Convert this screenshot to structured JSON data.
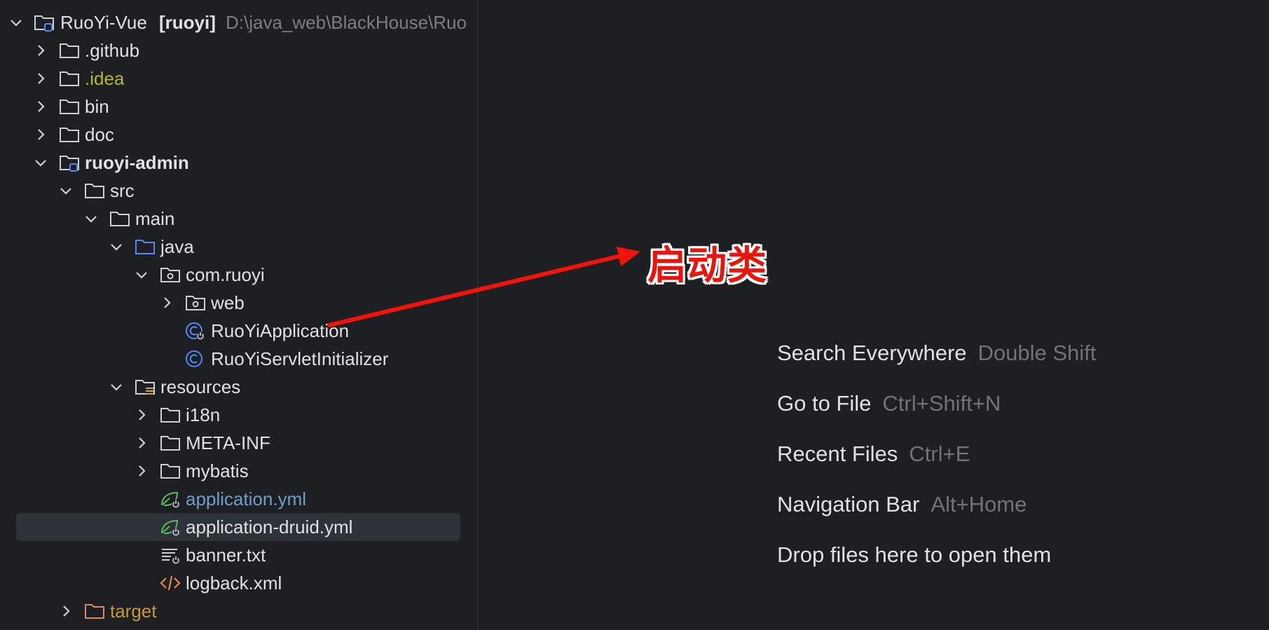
{
  "tree": {
    "root": {
      "name": "RuoYi-Vue",
      "module": "[ruoyi]",
      "path": "D:\\java_web\\BlackHouse\\Ruo"
    },
    "items": [
      {
        "label": ".github"
      },
      {
        "label": ".idea"
      },
      {
        "label": "bin"
      },
      {
        "label": "doc"
      },
      {
        "label": "ruoyi-admin"
      },
      {
        "label": "src"
      },
      {
        "label": "main"
      },
      {
        "label": "java"
      },
      {
        "label": "com.ruoyi"
      },
      {
        "label": "web"
      },
      {
        "label": "RuoYiApplication"
      },
      {
        "label": "RuoYiServletInitializer"
      },
      {
        "label": "resources"
      },
      {
        "label": "i18n"
      },
      {
        "label": "META-INF"
      },
      {
        "label": "mybatis"
      },
      {
        "label": "application.yml"
      },
      {
        "label": "application-druid.yml"
      },
      {
        "label": "banner.txt"
      },
      {
        "label": "logback.xml"
      },
      {
        "label": "target"
      }
    ]
  },
  "editor_hints": [
    {
      "action": "Search Everywhere",
      "shortcut": "Double Shift"
    },
    {
      "action": "Go to File",
      "shortcut": "Ctrl+Shift+N"
    },
    {
      "action": "Recent Files",
      "shortcut": "Ctrl+E"
    },
    {
      "action": "Navigation Bar",
      "shortcut": "Alt+Home"
    },
    {
      "action": "Drop files here to open them",
      "shortcut": ""
    }
  ],
  "annotation": {
    "label": "启动类",
    "color": "#e8150c"
  },
  "colors": {
    "background": "#1e1f22",
    "selection": "#2e3239",
    "text": "#dfe1e5",
    "muted": "#7a7e85",
    "excluded_yellow": "#b5b52e",
    "modified_blue": "#6f9ec9",
    "source_folder_blue": "#548af7",
    "java_class_blue": "#548af7",
    "spring_green": "#5fb865",
    "xml_orange": "#e08855"
  }
}
